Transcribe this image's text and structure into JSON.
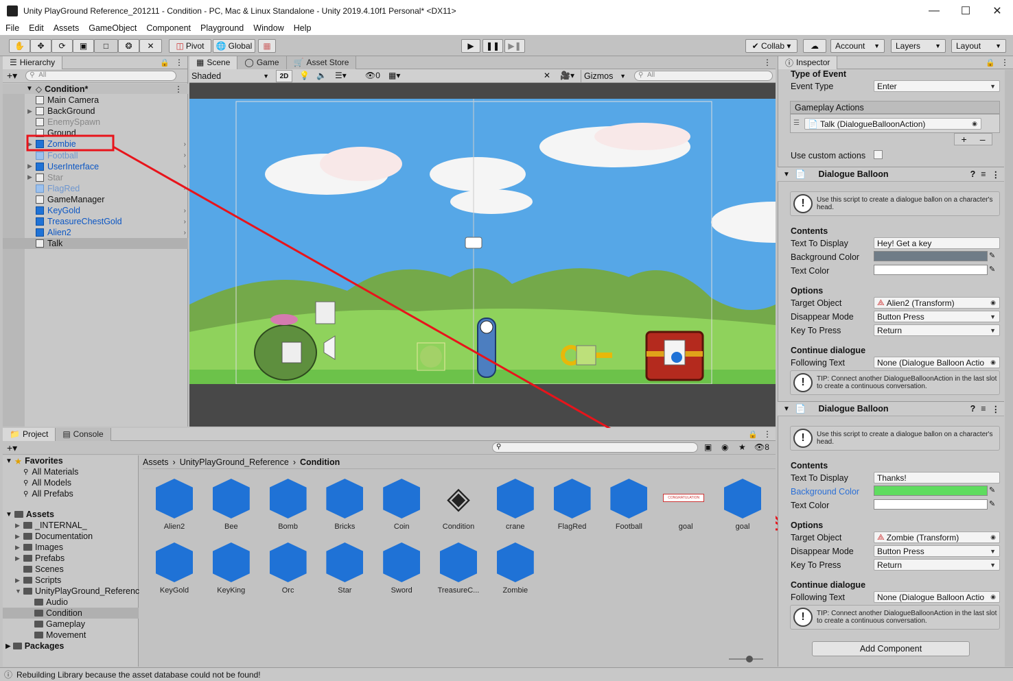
{
  "window": {
    "title": "Unity PlayGround Reference_201211 - Condition - PC, Mac & Linux Standalone - Unity 2019.4.10f1 Personal* <DX11>"
  },
  "menu": [
    "File",
    "Edit",
    "Assets",
    "GameObject",
    "Component",
    "Playground",
    "Window",
    "Help"
  ],
  "toolbar": {
    "pivot": "Pivot",
    "global": "Global",
    "collab": "Collab",
    "account": "Account",
    "layers": "Layers",
    "layout": "Layout"
  },
  "hierarchy": {
    "tab": "Hierarchy",
    "search_placeholder": "All",
    "scene": "Condition*",
    "items": [
      {
        "label": "Main Camera",
        "style": "normal"
      },
      {
        "label": "BackGround",
        "style": "normal"
      },
      {
        "label": "EnemySpawn",
        "style": "disabled"
      },
      {
        "label": "Ground",
        "style": "normal"
      },
      {
        "label": "Zombie",
        "style": "prefab"
      },
      {
        "label": "Football",
        "style": "prefab-disabled"
      },
      {
        "label": "UserInterface",
        "style": "prefab"
      },
      {
        "label": "Star",
        "style": "disabled"
      },
      {
        "label": "FlagRed",
        "style": "prefab-disabled"
      },
      {
        "label": "GameManager",
        "style": "normal"
      },
      {
        "label": "KeyGold",
        "style": "prefab"
      },
      {
        "label": "TreasureChestGold",
        "style": "prefab"
      },
      {
        "label": "Alien2",
        "style": "prefab"
      },
      {
        "label": "Talk",
        "style": "selected"
      }
    ]
  },
  "scene_view": {
    "tabs": [
      "Scene",
      "Game",
      "Asset Store"
    ],
    "shading": "Shaded",
    "mode_2d": "2D",
    "hidden_count": "0",
    "gizmos": "Gizmos",
    "search_placeholder": "All"
  },
  "project": {
    "tabs": [
      "Project",
      "Console"
    ],
    "count": "8",
    "favorites_label": "Favorites",
    "favorites": [
      "All Materials",
      "All Models",
      "All Prefabs"
    ],
    "assets_label": "Assets",
    "folders": [
      "_INTERNAL_",
      "Documentation",
      "Images",
      "Prefabs",
      "Scenes",
      "Scripts",
      "UnityPlayGround_Referenc"
    ],
    "subfolders": [
      "Audio",
      "Condition",
      "Gameplay",
      "Movement"
    ],
    "packages_label": "Packages",
    "breadcrumb": [
      "Assets",
      "UnityPlayGround_Reference",
      "Condition"
    ],
    "assets_row1": [
      "Alien2",
      "Bee",
      "Bomb",
      "Bricks",
      "Coin",
      "Condition",
      "crane",
      "FlagRed",
      "Football",
      "goal",
      "goal"
    ],
    "assets_row2": [
      "KeyGold",
      "KeyKing",
      "Orc",
      "Star",
      "Sword",
      "TreasureC...",
      "Zombie"
    ],
    "goal_banner": "CONGRATULATION"
  },
  "inspector": {
    "tab": "Inspector",
    "type_of_event": "Type of Event",
    "event_type_label": "Event Type",
    "event_type_value": "Enter",
    "gameplay_actions": "Gameplay Actions",
    "talk_action": "Talk (DialogueBalloonAction)",
    "use_custom_actions": "Use custom actions",
    "components": [
      {
        "title": "Dialogue Balloon",
        "help": "Use this script to create a dialogue ballon on a character's head.",
        "contents": "Contents",
        "text_to_display_label": "Text To Display",
        "text_to_display": "Hey! Get a key",
        "bg_color_label": "Background Color",
        "bg_color": "#6f7c87",
        "text_color_label": "Text Color",
        "options": "Options",
        "target_label": "Target Object",
        "target": "Alien2 (Transform)",
        "disappear_label": "Disappear Mode",
        "disappear": "Button Press",
        "key_label": "Key To Press",
        "key": "Return",
        "continue": "Continue dialogue",
        "following_label": "Following Text",
        "following": "None (Dialogue Balloon Actio",
        "tip": "TIP: Connect another DialogueBalloonAction in the last slot to create a continuous conversation."
      },
      {
        "title": "Dialogue Balloon",
        "help": "Use this script to create a dialogue ballon on a character's head.",
        "contents": "Contents",
        "text_to_display_label": "Text To Display",
        "text_to_display": "Thanks!",
        "bg_color_label": "Background Color",
        "bg_color": "#5fdc5f",
        "text_color_label": "Text Color",
        "options": "Options",
        "target_label": "Target Object",
        "target": "Zombie (Transform)",
        "disappear_label": "Disappear Mode",
        "disappear": "Button Press",
        "key_label": "Key To Press",
        "key": "Return",
        "continue": "Continue dialogue",
        "following_label": "Following Text",
        "following": "None (Dialogue Balloon Actio",
        "tip": "TIP: Connect another DialogueBalloonAction in the last slot to create a continuous conversation."
      }
    ],
    "add_component": "Add Component"
  },
  "status": "Rebuilding Library because the asset database could not be found!",
  "colors": {
    "accent_red": "#e8141b",
    "prefab_blue": "#1f72d6",
    "sky": "#4ea3e6",
    "grass": "#6cc24a"
  }
}
